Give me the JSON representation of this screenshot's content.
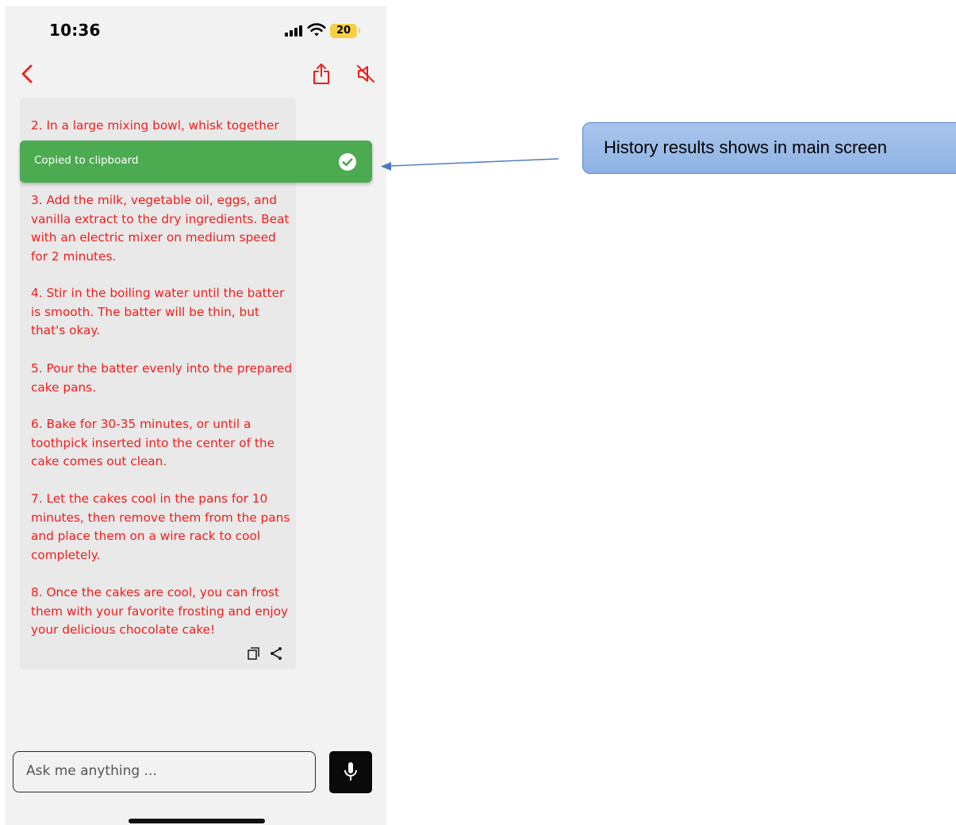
{
  "status_bar": {
    "time": "10:36",
    "battery": "20"
  },
  "header": {
    "back_icon": "chevron-left-icon",
    "share_icon": "share-icon",
    "mute_icon": "speaker-muted-icon",
    "accent_color": "#f21d1d"
  },
  "messages": [
    "2. In a large mixing bowl, whisk together",
    "3. Add the milk, vegetable oil, eggs, and vanilla extract to the dry ingredients. Beat with an electric mixer on medium speed for 2 minutes.",
    "4. Stir in the boiling water until the batter is smooth. The batter will be thin, but that's okay.",
    "5. Pour the batter evenly into the prepared cake pans.",
    "6. Bake for 30-35 minutes, or until a toothpick inserted into the center of the cake comes out clean.",
    "7. Let the cakes cool in the pans for 10 minutes, then remove them from the pans and place them on a wire rack to cool completely.",
    "8. Once the cakes are cool, you can frost them with your favorite frosting and enjoy your delicious chocolate cake!"
  ],
  "toast": {
    "text": "Copied to clipboard",
    "color": "#4caa50",
    "icon": "check-circle-icon"
  },
  "input": {
    "placeholder": "Ask me anything ...",
    "value": ""
  },
  "mic_icon": "microphone-icon",
  "annotation": {
    "text": "History results shows in main screen"
  }
}
